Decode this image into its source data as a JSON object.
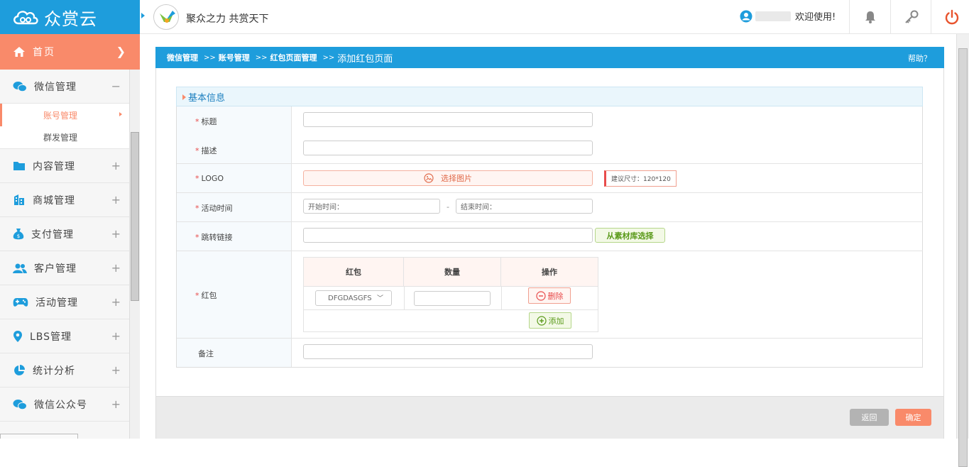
{
  "app": {
    "logo_text": "众赏云",
    "slogan": "聚众之力 共赏天下",
    "welcome": "欢迎使用!"
  },
  "sidebar": {
    "home_label": "首页",
    "items": [
      {
        "label": "微信管理",
        "icon": "wechat-icon",
        "sign": "−"
      },
      {
        "label": "内容管理",
        "icon": "folder-icon",
        "sign": "+"
      },
      {
        "label": "商城管理",
        "icon": "building-icon",
        "sign": "+"
      },
      {
        "label": "支付管理",
        "icon": "money-bag-icon",
        "sign": "+"
      },
      {
        "label": "客户管理",
        "icon": "users-icon",
        "sign": "+"
      },
      {
        "label": "活动管理",
        "icon": "gamepad-icon",
        "sign": "+"
      },
      {
        "label": "LBS管理",
        "icon": "location-pin-icon",
        "sign": "+"
      },
      {
        "label": "统计分析",
        "icon": "pie-chart-icon",
        "sign": "+"
      },
      {
        "label": "微信公众号",
        "icon": "wechat-icon",
        "sign": "+"
      }
    ],
    "subitems": [
      {
        "label": "账号管理",
        "active": true
      },
      {
        "label": "群发管理",
        "active": false
      }
    ]
  },
  "breadcrumb": {
    "items": [
      "微信管理",
      "账号管理",
      "红包页面管理"
    ],
    "separator": ">>",
    "current": "添加红包页面",
    "help": "帮助？"
  },
  "section": {
    "title": "基本信息"
  },
  "form": {
    "title_label": "标题",
    "desc_label": "描述",
    "logo_label": "LOGO",
    "upload_label": "选择图片",
    "logo_hint": "建议尺寸：120*120",
    "time_label": "活动时间",
    "start_placeholder": "开始时间：",
    "time_sep": "-",
    "end_placeholder": "结束时间：",
    "link_label": "跳转链接",
    "pick_label": "从素材库选择",
    "redpack_label": "红包",
    "remark_label": "备注",
    "required_mark": "*"
  },
  "redpack_table": {
    "headers": [
      "红包",
      "数量",
      "操作"
    ],
    "row": {
      "selected": "DFGDASGFS",
      "quantity": ""
    },
    "delete_label": "删除",
    "add_label": "添加"
  },
  "footer": {
    "back_label": "返回",
    "ok_label": "确定"
  },
  "colors": {
    "primary": "#1e9ddc",
    "accent": "#f98a6a",
    "danger": "#e84b4b",
    "success": "#5a9a1a"
  }
}
